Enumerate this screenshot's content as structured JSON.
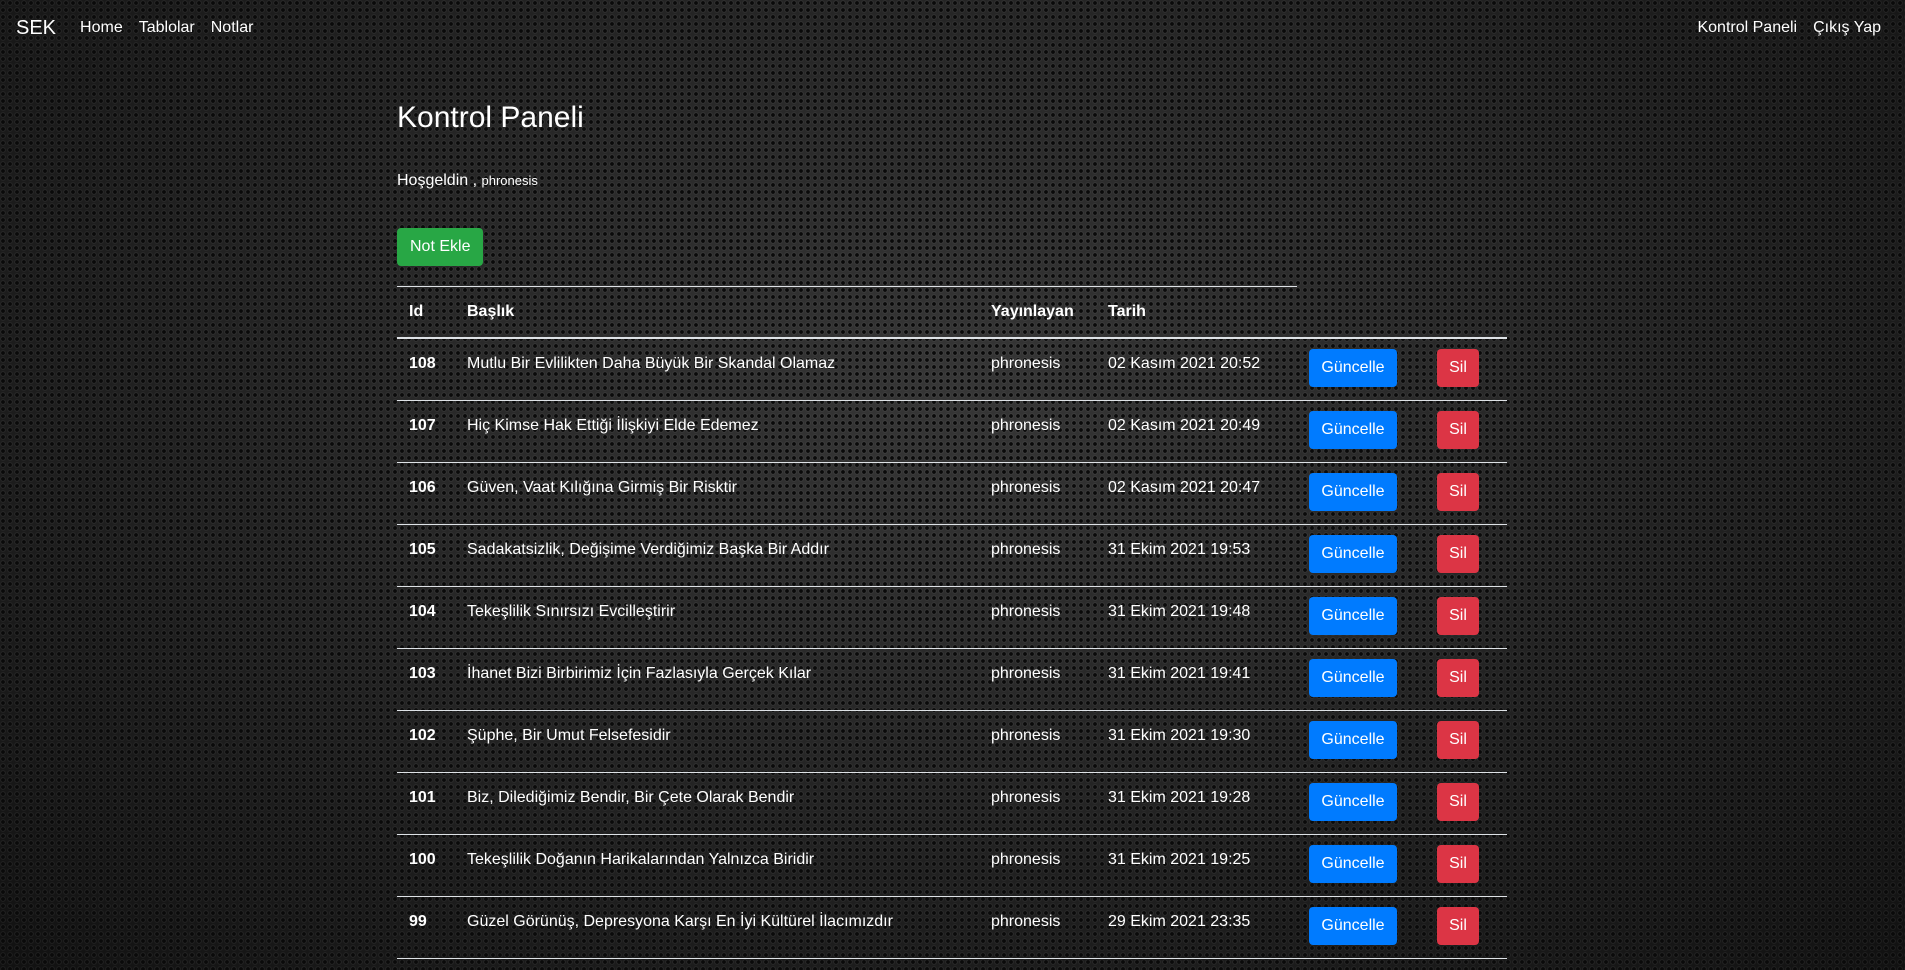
{
  "navbar": {
    "brand": "SEK",
    "links": [
      "Home",
      "Tablolar",
      "Notlar"
    ],
    "right_links": [
      "Kontrol Paneli",
      "Çıkış Yap"
    ]
  },
  "page": {
    "title": "Kontrol Paneli",
    "welcome_text": "Hoşgeldin ,",
    "username": "phronesis",
    "add_button": "Not Ekle"
  },
  "table": {
    "headers": [
      "Id",
      "Başlık",
      "Yayınlayan",
      "Tarih"
    ],
    "update_label": "Güncelle",
    "delete_label": "Sil",
    "rows": [
      {
        "id": "108",
        "title": "Mutlu Bir Evlilikten Daha Büyük Bir Skandal Olamaz",
        "author": "phronesis",
        "date": "02 Kasım 2021 20:52"
      },
      {
        "id": "107",
        "title": "Hiç Kimse Hak Ettiği İlişkiyi Elde Edemez",
        "author": "phronesis",
        "date": "02 Kasım 2021 20:49"
      },
      {
        "id": "106",
        "title": "Güven, Vaat Kılığına Girmiş Bir Risktir",
        "author": "phronesis",
        "date": "02 Kasım 2021 20:47"
      },
      {
        "id": "105",
        "title": "Sadakatsizlik, Değişime Verdiğimiz Başka Bir Addır",
        "author": "phronesis",
        "date": "31 Ekim 2021 19:53"
      },
      {
        "id": "104",
        "title": "Tekeşlilik Sınırsızı Evcilleştirir",
        "author": "phronesis",
        "date": "31 Ekim 2021 19:48"
      },
      {
        "id": "103",
        "title": "İhanet Bizi Birbirimiz İçin Fazlasıyla Gerçek Kılar",
        "author": "phronesis",
        "date": "31 Ekim 2021 19:41"
      },
      {
        "id": "102",
        "title": "Şüphe, Bir Umut Felsefesidir",
        "author": "phronesis",
        "date": "31 Ekim 2021 19:30"
      },
      {
        "id": "101",
        "title": "Biz, Dilediğimiz Bendir, Bir Çete Olarak Bendir",
        "author": "phronesis",
        "date": "31 Ekim 2021 19:28"
      },
      {
        "id": "100",
        "title": "Tekeşlilik Doğanın Harikalarından Yalnızca Biridir",
        "author": "phronesis",
        "date": "31 Ekim 2021 19:25"
      },
      {
        "id": "99",
        "title": "Güzel Görünüş, Depresyona Karşı En İyi Kültürel İlacımızdır",
        "author": "phronesis",
        "date": "29 Ekim 2021 23:35"
      }
    ]
  },
  "colors": {
    "success": "#28a745",
    "primary": "#007bff",
    "danger": "#dc3545"
  }
}
